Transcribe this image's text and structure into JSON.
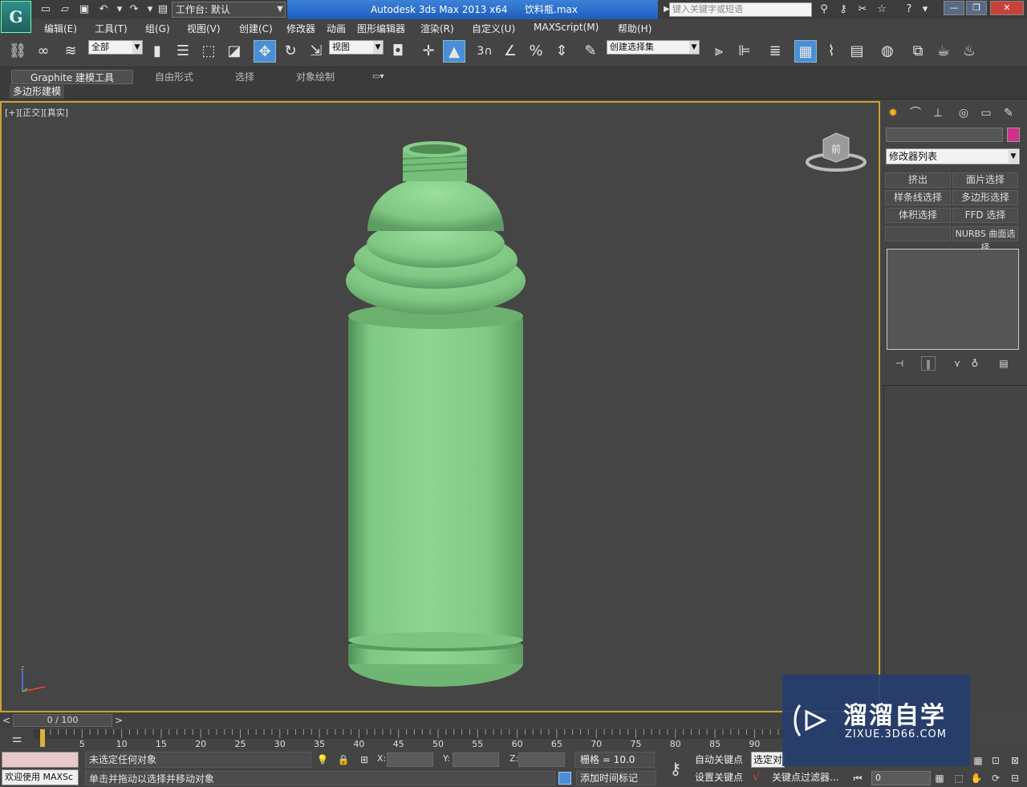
{
  "titlebar": {
    "workspace_label": "工作台: 默认",
    "app_title": "Autodesk 3ds Max  2013 x64",
    "file_name": "饮料瓶.max",
    "search_placeholder": "键入关键字或短语",
    "logo_letter": "G"
  },
  "menu": {
    "items": [
      "编辑(E)",
      "工具(T)",
      "组(G)",
      "视图(V)",
      "创建(C)",
      "修改器",
      "动画",
      "图形编辑器",
      "渲染(R)",
      "自定义(U)",
      "MAXScript(M)",
      "帮助(H)"
    ]
  },
  "toolbar": {
    "selection_filter": "全部",
    "ref_coord": "视图",
    "snap_num": "3",
    "named_selection": "创建选择集"
  },
  "ribbon": {
    "tabs": [
      "Graphite 建模工具",
      "自由形式",
      "选择",
      "对象绘制"
    ],
    "subtab": "多边形建模"
  },
  "viewport": {
    "label_plus": "[+]",
    "label_view": "[正交]",
    "label_shading": "[真实]",
    "viewcube_face": "前",
    "object_color": "#8ad28c",
    "border_color": "#c8a233"
  },
  "command_panel": {
    "modifier_list": "修改器列表",
    "object_color": "#d12f89",
    "buttons": [
      "挤出",
      "面片选择",
      "样条线选择",
      "多边形选择",
      "体积选择",
      "FFD 选择",
      "",
      "NURBS 曲面选择"
    ]
  },
  "timeline": {
    "frame_display": "0 / 100",
    "ticks": [
      "0",
      "5",
      "10",
      "15",
      "20",
      "25",
      "30",
      "35",
      "40",
      "45",
      "50",
      "55",
      "60",
      "65",
      "70",
      "75",
      "80",
      "85",
      "90"
    ]
  },
  "status": {
    "welcome": "欢迎使用 MAXSc",
    "selection": "未选定任何对象",
    "prompt": "单击并拖动以选择并移动对象",
    "x_label": "X:",
    "y_label": "Y:",
    "z_label": "Z:",
    "grid": "栅格 = 10.0",
    "add_time_tag": "添加时间标记",
    "auto_key": "自动关键点",
    "set_key": "设置关键点",
    "selected": "选定对",
    "key_filters": "关键点过滤器...",
    "current_frame": "0"
  },
  "watermark": {
    "title": "溜溜自学",
    "url": "ZIXUE.3D66.COM"
  }
}
